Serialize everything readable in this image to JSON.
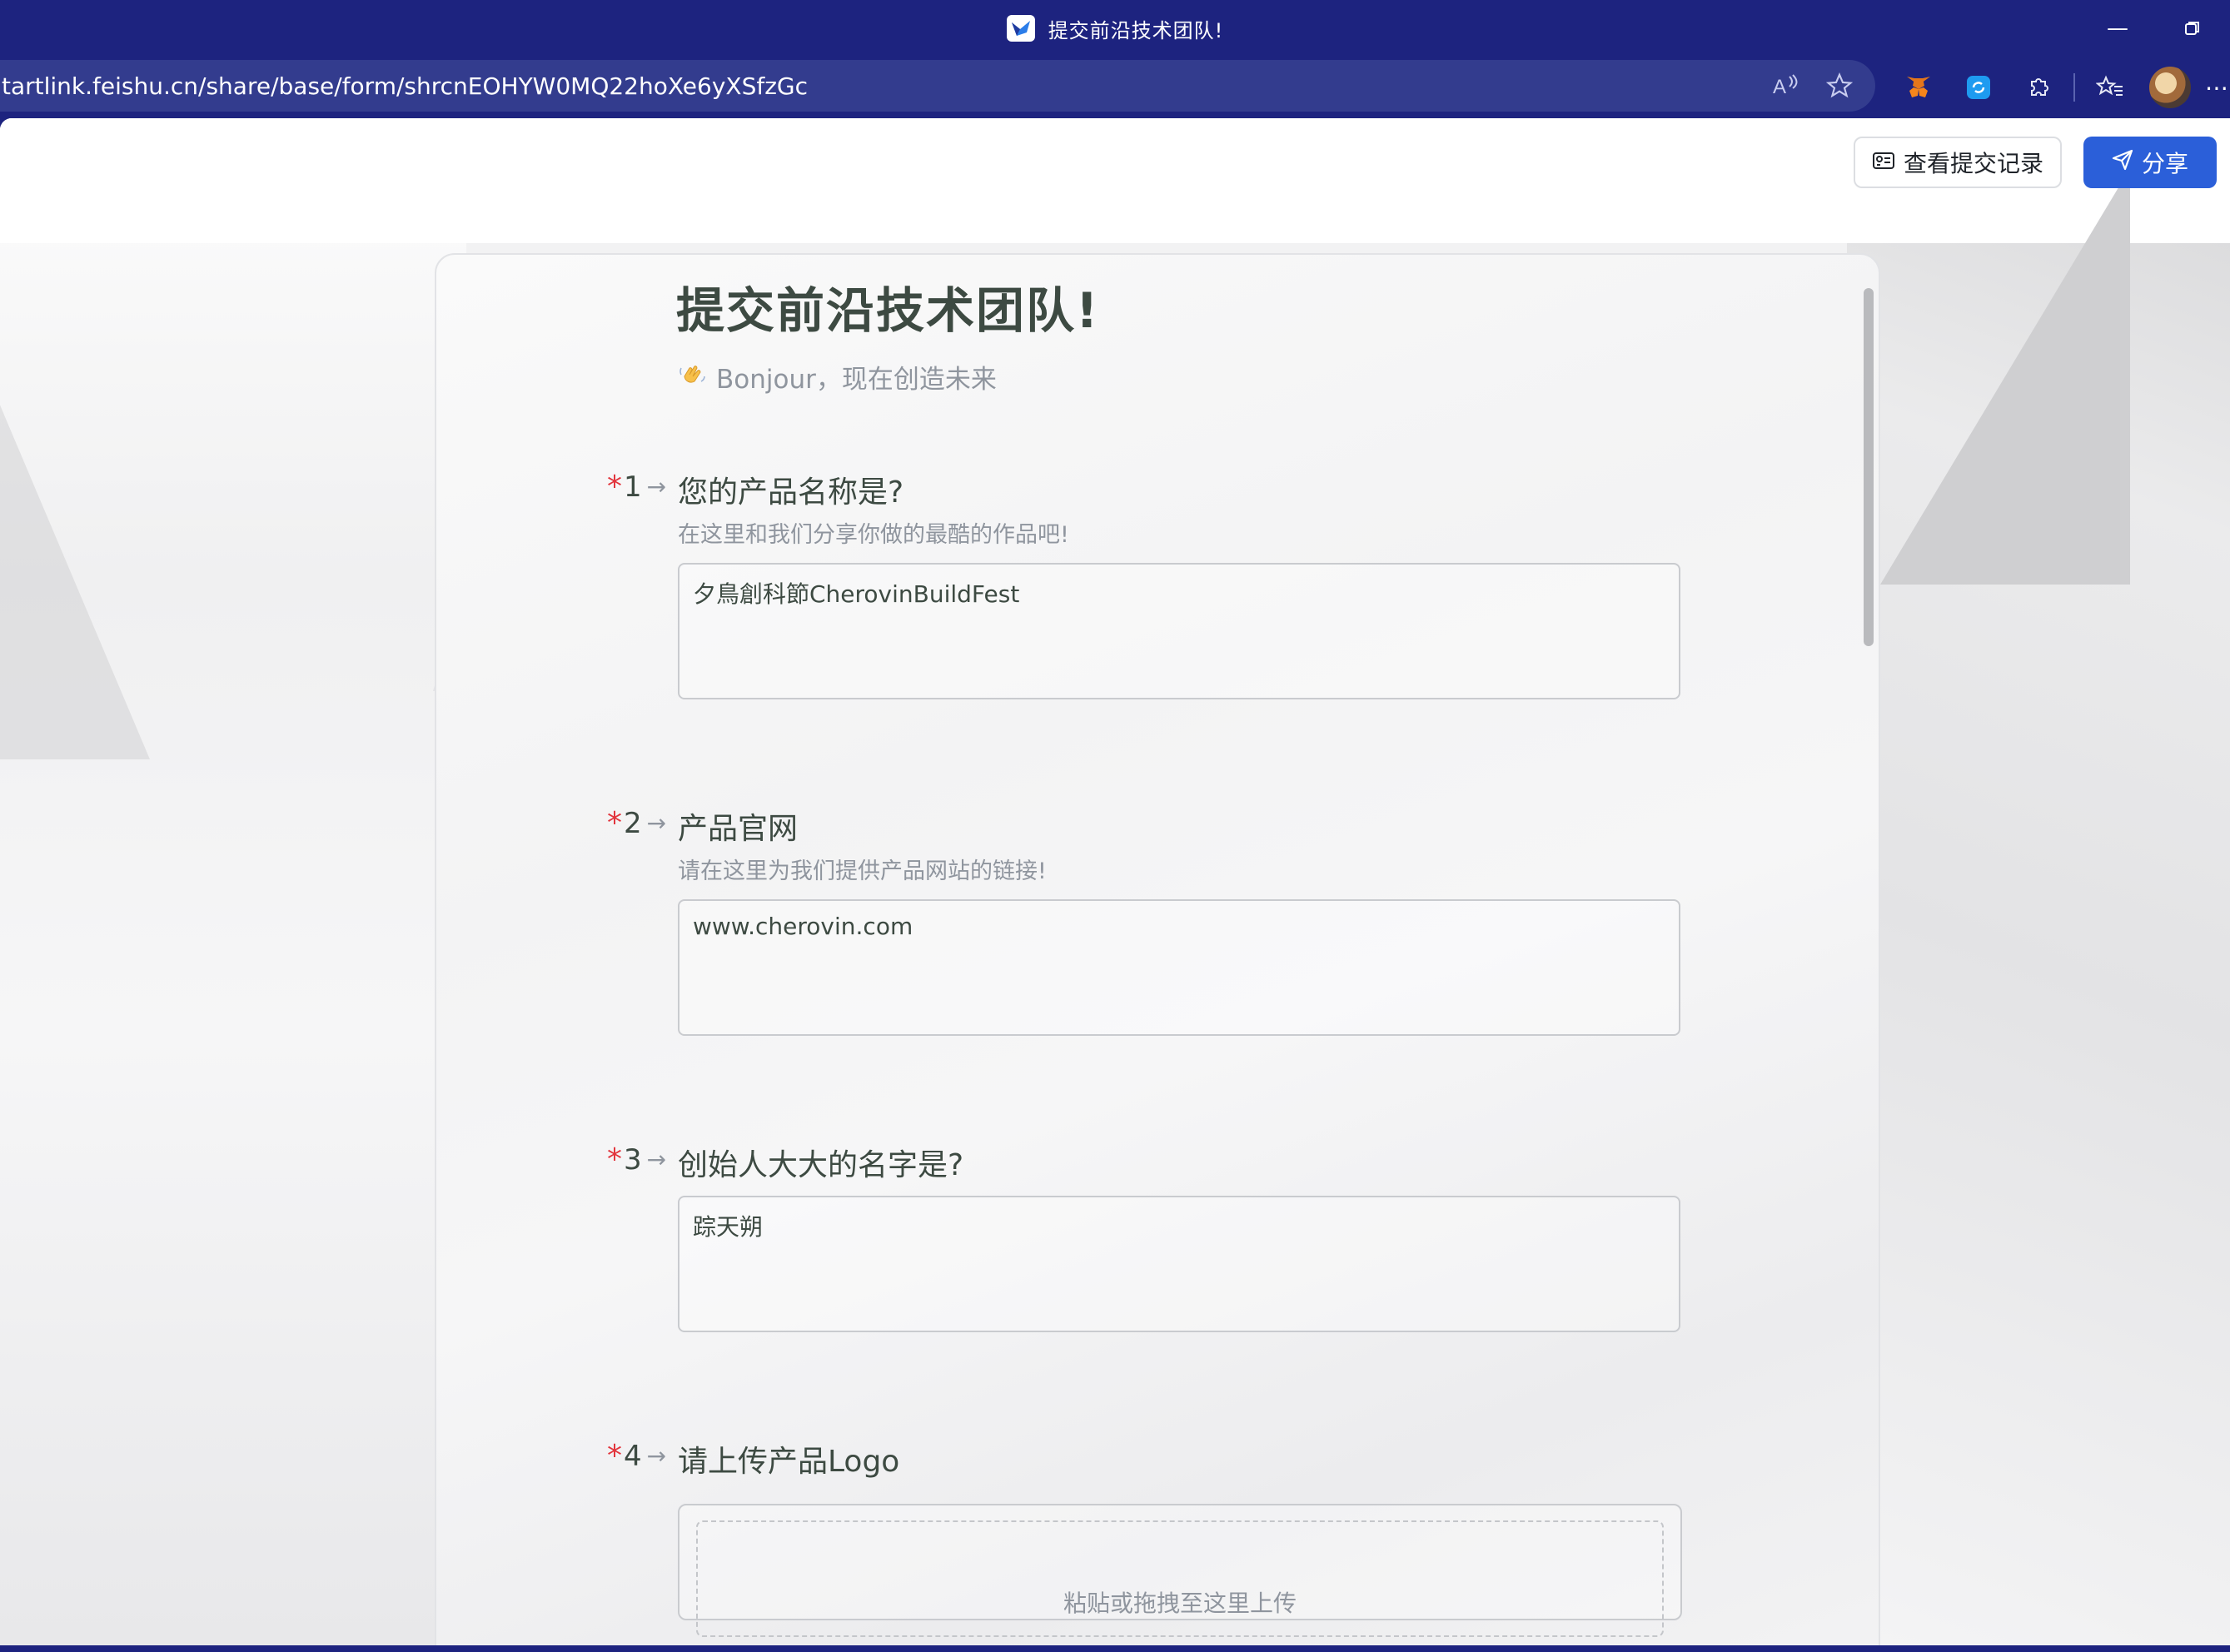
{
  "browser": {
    "tab_title": "提交前沿技术团队!",
    "url": "tartlink.feishu.cn/share/base/form/shrcnEOHYW0MQ22hoXe6yXSfzGc"
  },
  "header": {
    "records_label": "查看提交记录",
    "share_label": "分享",
    "share_color": "#2b5fd9"
  },
  "form": {
    "title": "提交前沿技术团队!",
    "subtitle": "Bonjour，现在创造未来",
    "subtitle_icon": "waving-hand-icon",
    "questions": [
      {
        "number": "1",
        "required": "*",
        "label": "您的产品名称是?",
        "description": "在这里和我们分享你做的最酷的作品吧!",
        "value": "夕鳥創科節CherovinBuildFest"
      },
      {
        "number": "2",
        "required": "*",
        "label": "产品官网",
        "description": "请在这里为我们提供产品网站的链接!",
        "value": "www.cherovin.com"
      },
      {
        "number": "3",
        "required": "*",
        "label": "创始人大大的名字是?",
        "value": "踪天朔"
      },
      {
        "number": "4",
        "required": "*",
        "label": "请上传产品Logo",
        "upload_hint": "粘贴或拖拽至这里上传"
      }
    ]
  },
  "colors": {
    "chrome": "#1d237f",
    "title_text": "#3d4a42",
    "required_star": "#e2353d"
  }
}
